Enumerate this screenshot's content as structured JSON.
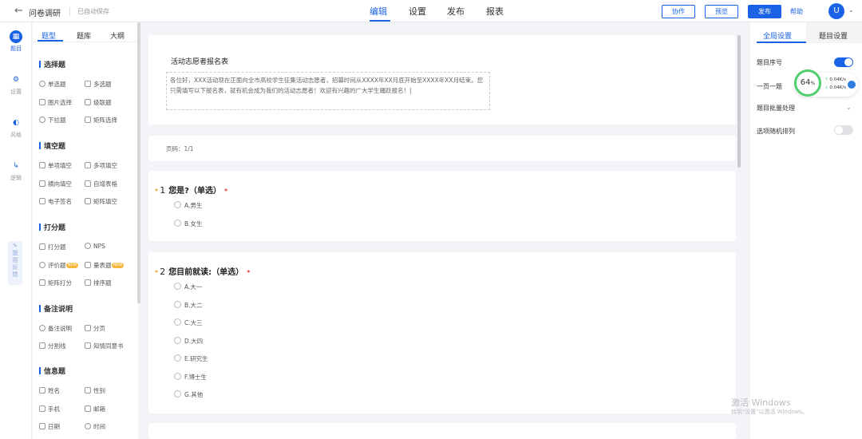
{
  "topbar": {
    "back_icon": "←",
    "app_title": "问卷调研",
    "autosave": "已自动保存",
    "tabs": [
      "编辑",
      "设置",
      "发布",
      "报表"
    ],
    "buttons": {
      "collab": "协作",
      "preview": "预览",
      "publish": "发布"
    },
    "help": "帮助",
    "avatar": "U",
    "caret": "⌄"
  },
  "leftrail": {
    "items": [
      {
        "icon": "▦",
        "label": "题目"
      },
      {
        "icon": "⚙",
        "label": "设置"
      },
      {
        "icon": "◐",
        "label": "风格"
      },
      {
        "icon": "↳",
        "label": "逻辑"
      }
    ],
    "feedback_icon": "✎",
    "feedback": [
      "提",
      "用",
      "反",
      "馈"
    ]
  },
  "qpanel": {
    "tabs": [
      "题型",
      "题库",
      "大纲"
    ],
    "groups": [
      {
        "title": "选择题",
        "items": [
          "单选题",
          "多选题",
          "图片选择",
          "级联题",
          "下拉题",
          "矩阵选择"
        ]
      },
      {
        "title": "填空题",
        "items": [
          "单项填空",
          "多项填空",
          "横向填空",
          "自增表格",
          "电子签名",
          "矩阵填空"
        ]
      },
      {
        "title": "打分题",
        "items": [
          "打分题",
          "NPS",
          "评价题",
          "量表题",
          "矩阵打分",
          "排序题"
        ]
      },
      {
        "title": "备注说明",
        "items": [
          "备注说明",
          "分页",
          "分割线",
          "知情同意书"
        ]
      },
      {
        "title": "信息题",
        "items": [
          "姓名",
          "性别",
          "手机",
          "邮箱",
          "日期",
          "时间"
        ]
      }
    ],
    "new_badge": "NEW"
  },
  "survey": {
    "title": "活动志愿者报名表",
    "description": "各位好，XXX活动现在正面向全市高校学生征集活动志愿者，招募时间从XXXX年XX月底开始至XXXX年XX月结束。您只需填写以下报名表，就有机会成为我们的活动志愿者！欢迎有兴趣的广大学生踊跃报名！|",
    "page": "页码：1/1",
    "questions": [
      {
        "star": "*",
        "num": "1",
        "title": "您是?",
        "type": "（单选）",
        "req": "*",
        "options": [
          "A.男生",
          "B.女生"
        ]
      },
      {
        "star": "*",
        "num": "2",
        "title": "您目前就读:",
        "type": "（单选）",
        "req": "*",
        "options": [
          "A.大一",
          "B.大二",
          "C.大三",
          "D.大四",
          "E.研究生",
          "F.博士生",
          "G.其他"
        ]
      }
    ]
  },
  "rightpanel": {
    "tabs": [
      "全局设置",
      "题目设置"
    ],
    "rows": {
      "numbering": "题目序号",
      "one_per_page": "一页一题",
      "batch": "题目批量处理",
      "random": "选项随机排列"
    },
    "numbering_on": true,
    "random_on": false,
    "chevron": "⌄"
  },
  "net_widget": {
    "percent": "64",
    "unit": "%",
    "up": "0.04K/s",
    "down": "0.04K/s",
    "up_arrow": "↑",
    "down_arrow": "↓",
    "ring_color": "#4ccf6c"
  },
  "watermark": {
    "line1": "激活 Windows",
    "line2": "转到\"设置\"以激活 Windows。"
  },
  "colors": {
    "accent": "#1a62e6",
    "badge": "#f6b73c",
    "required": "#e23b3b"
  }
}
